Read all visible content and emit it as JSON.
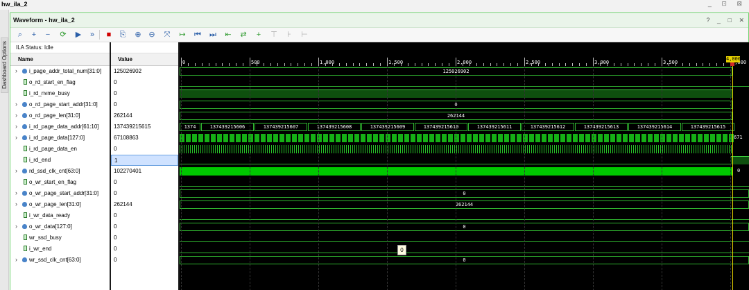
{
  "window": {
    "title": "hw_ila_2",
    "controls": "_ ⊡ ⊠"
  },
  "side_tab": {
    "label": "Dashboard Options"
  },
  "panel": {
    "title": "Waveform - hw_ila_2",
    "controls": "? _ □ ✕"
  },
  "toolbar": {
    "icons": [
      "search-icon",
      "plus-icon",
      "minus-icon",
      "settings-icon",
      "run-icon",
      "run-all-icon",
      "stop-icon",
      "export-icon",
      "zoom-in-icon",
      "zoom-out-icon",
      "zoom-fit-icon",
      "cursor-icon",
      "go-first-icon",
      "go-last-icon",
      "add-marker-icon",
      "swap-icon",
      "add-icon",
      "marker-gray-icon",
      "marker-gray2-icon",
      "marker-gray3-icon"
    ]
  },
  "status": {
    "text": "ILA Status:  Idle"
  },
  "columns": {
    "name": "Name",
    "value": "Value"
  },
  "signals": [
    {
      "name": "i_page_addr_total_num[31:0]",
      "value": "125026902",
      "bus": true
    },
    {
      "name": "o_rd_start_en_flag",
      "value": "0",
      "bus": false
    },
    {
      "name": "i_rd_nvme_busy",
      "value": "0",
      "bus": false
    },
    {
      "name": "o_rd_page_start_addr[31:0]",
      "value": "0",
      "bus": true
    },
    {
      "name": "o_rd_page_len[31:0]",
      "value": "262144",
      "bus": true
    },
    {
      "name": "i_rd_page_data_addr[61:10]",
      "value": "137439215615",
      "bus": true
    },
    {
      "name": "i_rd_page_data[127:0]",
      "value": "67108863",
      "bus": true
    },
    {
      "name": "i_rd_page_data_en",
      "value": "0",
      "bus": false
    },
    {
      "name": "i_rd_end",
      "value": "1",
      "bus": false,
      "selected": true
    },
    {
      "name": "rd_ssd_clk_cnt[63:0]",
      "value": "102270401",
      "bus": true
    },
    {
      "name": "o_wr_start_en_flag",
      "value": "0",
      "bus": false
    },
    {
      "name": "o_wr_page_start_addr[31:0]",
      "value": "0",
      "bus": true
    },
    {
      "name": "o_wr_page_len[31:0]",
      "value": "262144",
      "bus": true
    },
    {
      "name": "i_wr_data_ready",
      "value": "0",
      "bus": false
    },
    {
      "name": "o_wr_data[127:0]",
      "value": "0",
      "bus": true
    },
    {
      "name": "wr_ssd_busy",
      "value": "0",
      "bus": false
    },
    {
      "name": "i_wr_end",
      "value": "0",
      "bus": false
    },
    {
      "name": "wr_ssd_clk_cnt[63:0]",
      "value": "0",
      "bus": true
    }
  ],
  "ruler": {
    "ticks": [
      "0",
      "500",
      "1,000",
      "1,500",
      "2,000",
      "2,500",
      "3,000",
      "3,500",
      "4,000"
    ],
    "cursor_label": "4,000"
  },
  "waves": {
    "page_addr_total_num": "125026902",
    "rd_page_start_addr": "0",
    "rd_page_len": "262144",
    "rd_page_data_addr_segments": [
      "1374",
      "137439215606",
      "137439215607",
      "137439215608",
      "137439215609",
      "137439215610",
      "137439215611",
      "137439215612",
      "137439215613",
      "137439215614",
      "137439215615"
    ],
    "rd_page_data_end_label": "671",
    "rd_ssd_clk_end_label": "0",
    "wr_page_start_addr": "0",
    "wr_page_len": "262144",
    "wr_data": "0",
    "wr_ssd_clk_cnt": "0"
  },
  "tooltip": {
    "text": "0"
  },
  "colors": {
    "waveform_green": "#2fb52f",
    "cursor_yellow": "#e8d200",
    "selection_blue": "#cfe2ff"
  }
}
